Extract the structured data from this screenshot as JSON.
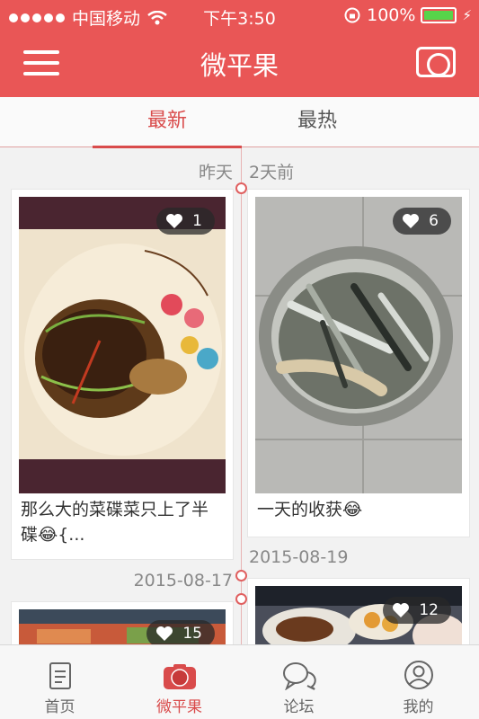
{
  "status": {
    "carrier": "中国移动",
    "time": "下午3:50",
    "battery": "100%"
  },
  "header": {
    "title": "微平果"
  },
  "tabs": [
    {
      "label": "最新"
    },
    {
      "label": "最热"
    }
  ],
  "feed": {
    "left": [
      {
        "date": "昨天",
        "likes": "1",
        "caption": "那么大的菜碟菜只上了半碟😂{..."
      },
      {
        "date": "2015-08-17",
        "likes": "15",
        "caption": ""
      }
    ],
    "right": [
      {
        "date": "2天前",
        "likes": "6",
        "caption": "一天的收获😂"
      },
      {
        "date": "2015-08-19",
        "likes": "12",
        "caption": ""
      }
    ]
  },
  "tabbar": [
    {
      "label": "首页",
      "icon": "document-icon"
    },
    {
      "label": "微平果",
      "icon": "camera-icon"
    },
    {
      "label": "论坛",
      "icon": "chat-bubbles-icon"
    },
    {
      "label": "我的",
      "icon": "profile-icon"
    }
  ],
  "colors": {
    "accent": "#e95656",
    "tab_active": "#d94b4b"
  }
}
